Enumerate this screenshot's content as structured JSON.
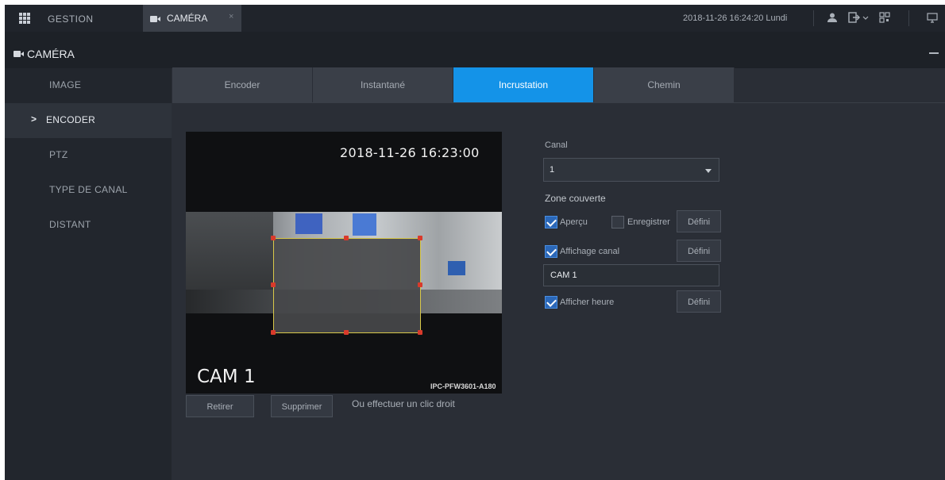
{
  "topbar": {
    "gestion": "GESTION",
    "tab_label": "CAMÉRA",
    "tab_close": "×",
    "datetime": "2018-11-26 16:24:20 Lundi"
  },
  "title": {
    "label": "CAMÉRA"
  },
  "sidebar": {
    "items": [
      {
        "label": "IMAGE",
        "active": false
      },
      {
        "label": "ENCODER",
        "active": true
      },
      {
        "label": "PTZ",
        "active": false
      },
      {
        "label": "TYPE DE CANAL",
        "active": false
      },
      {
        "label": "DISTANT",
        "active": false
      }
    ],
    "active_marker": ">"
  },
  "tabs": [
    {
      "label": "Encoder"
    },
    {
      "label": "Instantané"
    },
    {
      "label": "Incrustation",
      "active": true
    },
    {
      "label": "Chemin"
    }
  ],
  "preview": {
    "datetime": "2018-11-26 16:23:00",
    "channel_name": "CAM 1",
    "model": "IPC-PFW3601-A180"
  },
  "actions": {
    "remove_label": "Retirer",
    "delete_label": "Supprimer",
    "hint": "Ou effectuer un clic droit"
  },
  "form": {
    "canal_label": "Canal",
    "canal_value": "1",
    "zone_label": "Zone couverte",
    "apercu": {
      "label": "Aperçu",
      "checked": true
    },
    "enregistrer": {
      "label": "Enregistrer",
      "checked": false
    },
    "affichage_canal": {
      "label": "Affichage canal",
      "checked": true
    },
    "channel_title_value": "CAM 1",
    "afficher_heure": {
      "label": "Afficher heure",
      "checked": true
    },
    "define_label": "Défini"
  },
  "colors": {
    "accent": "#1493e8",
    "handle": "#d93a2b",
    "mask_border": "#d8c84a"
  }
}
